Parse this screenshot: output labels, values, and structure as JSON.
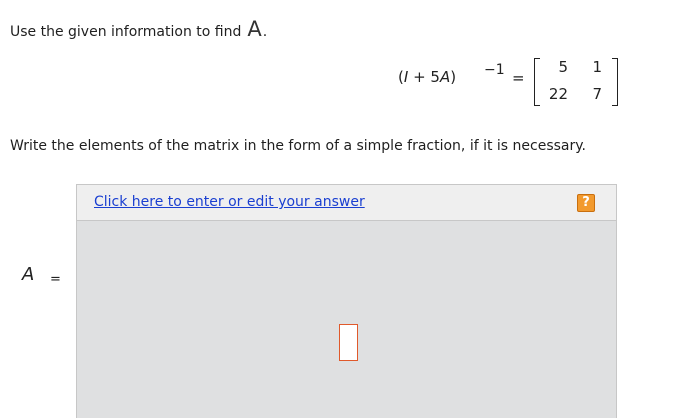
{
  "question": {
    "instruction": "Use the given information to find",
    "variable": "A",
    "period": "."
  },
  "equation": {
    "lhs_prefix": "(",
    "lhs_identity": "I",
    "lhs_middle": " + 5",
    "lhs_variable": "A",
    "lhs_suffix": ")",
    "exponent": "−1",
    "equals": "=",
    "matrix": [
      [
        "5",
        "1"
      ],
      [
        "22",
        "7"
      ]
    ]
  },
  "note": "Write the elements of the matrix in the form of a simple fraction, if it is necessary.",
  "answer_panel": {
    "link_text": "Click here to enter or edit your answer",
    "help_label": "?",
    "answer_value": ""
  },
  "answer_lhs": {
    "variable": "A",
    "equals": "="
  },
  "colors": {
    "link": "#1a3fd1",
    "help_button": "#f29a2e",
    "answer_box_border": "#e0592b",
    "panel_background": "#dfe0e1"
  }
}
